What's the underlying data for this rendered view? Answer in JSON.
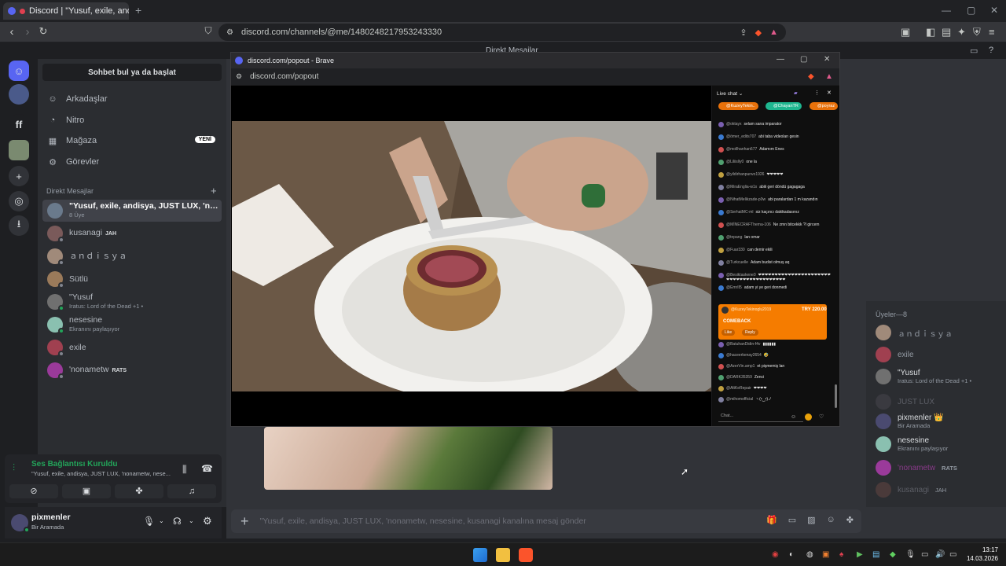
{
  "browser": {
    "tab_title": "Discord | \"Yusuf, exile, andisy...",
    "url": "discord.com/channels/@me/1480248217953243330"
  },
  "discord_top": {
    "title": "Direkt Mesajlar"
  },
  "sidebar": {
    "search": "Sohbet bul ya da başlat",
    "nav": [
      {
        "label": "Arkadaşlar",
        "icon": "friends-icon"
      },
      {
        "label": "Nitro",
        "icon": "nitro-icon"
      },
      {
        "label": "Mağaza",
        "icon": "shop-icon"
      },
      {
        "label": "Görevler",
        "icon": "quests-icon"
      }
    ],
    "new_badge": "YENİ",
    "dm_header": "Direkt Mesajlar",
    "dms": [
      {
        "name": "\"Yusuf, exile, andisya, JUST LUX, 'nona...",
        "sub": "8 Üye",
        "tag": "",
        "color": "#6a7a8c"
      },
      {
        "name": "kusanagi",
        "sub": "",
        "tag": "JAH",
        "color": "#7a5a5a"
      },
      {
        "name": "ａｎｄｉｓｙａ",
        "sub": "",
        "tag": "",
        "color": "#a08a7a"
      },
      {
        "name": "Sütlü",
        "sub": "",
        "tag": "",
        "color": "#9a7a5a"
      },
      {
        "name": "\"Yusuf",
        "sub": "Iratus: Lord of the Dead +1 •",
        "tag": "",
        "color": "#707070"
      },
      {
        "name": "nesesine",
        "sub": "Ekranını paylaşıyor",
        "tag": "",
        "color": "#8ac0b0"
      },
      {
        "name": "exile",
        "sub": "",
        "tag": "",
        "color": "#a04050"
      },
      {
        "name": "'nonametw",
        "sub": "",
        "tag": "RATS",
        "color": "#9a3a9a"
      }
    ]
  },
  "voice": {
    "status": "Ses Bağlantısı Kuruldu",
    "channel": "\"Yusuf, exile, andisya, JUST LUX, 'nonametw, nese..."
  },
  "user": {
    "name": "pixmenler",
    "status": "Bir Aramada"
  },
  "popout": {
    "title": "discord.com/popout - Brave",
    "url": "discord.com/popout"
  },
  "livechat": {
    "header": "Live chat",
    "pills": [
      "@KuzeyTekin..",
      "@ChayanTR",
      "@poyraz"
    ],
    "messages": [
      {
        "user": "@oktayx",
        "text": "selam sana imparator"
      },
      {
        "user": "@ömer_edits707",
        "text": "abi taba videoları gesin"
      },
      {
        "user": "@mollhanhan677",
        "text": "Adamım Enes"
      },
      {
        "user": "@Liliislly0",
        "text": "one la"
      },
      {
        "user": "@yildirhanpunvo1926",
        "text": "❤❤❤❤❤"
      },
      {
        "user": "@MiraEnglia-w1x",
        "text": "abiii geri döndü gagagaga"
      },
      {
        "user": "@NihatMelikzade-p0w",
        "text": "abi paralardan 1 m kazandın"
      },
      {
        "user": "@SerhatMC-ml",
        "text": "siz kaçıncı dakikadasınız"
      },
      {
        "user": "@MİNECRAFThema-106",
        "text": "Ne zmn bitcekkk ?I gircem"
      },
      {
        "user": "@tnpang",
        "text": "lan omar"
      },
      {
        "user": "@Fuar330",
        "text": "can demir ekili"
      },
      {
        "user": "@Turkcuelle",
        "text": "Adam budist olmuş aq"
      },
      {
        "user": "@Besiktaskene0",
        "text": "❤❤❤❤❤❤❤❤❤❤❤❤❤❤❤❤❤❤❤❤❤❤❤❤❤❤❤❤❤❤❤❤❤❤❤❤❤❤❤❤"
      },
      {
        "user": "@EmrII5",
        "text": "adam yi ye geri donmedi"
      }
    ],
    "superchat": {
      "user": "@KuzeyTekinoglu2019",
      "amount": "TRY 220.00",
      "text": "COMEBACK",
      "actions": [
        "Like",
        "Reply"
      ]
    },
    "messages2": [
      {
        "user": "@BatuhanDidin-f4v",
        "text": "▮▮▮▮▮▮"
      },
      {
        "user": "@haceerkenay2654",
        "text": "🤣"
      },
      {
        "user": "@AzerVin.amp1",
        "text": "et pişmemiş lan"
      },
      {
        "user": "@DARK35359",
        "text": "Zenci"
      },
      {
        "user": "@AltKeRepair",
        "text": "❤❤❤❤"
      },
      {
        "user": "@mihomofficial",
        "text": "ヽ(•‿•)ノ"
      }
    ],
    "input_placeholder": "Chat..."
  },
  "members": {
    "header": "Üyeler—8",
    "list": [
      {
        "name": "ａｎｄｉｓｙａ",
        "sub": ""
      },
      {
        "name": "exile",
        "sub": ""
      },
      {
        "name": "\"Yusuf",
        "sub": "Iratus: Lord of the Dead +1 •"
      },
      {
        "name": "JUST LUX",
        "sub": ""
      },
      {
        "name": "pixmenler 👑",
        "sub": "Bir Aramada"
      },
      {
        "name": "nesesine",
        "sub": "Ekranını paylaşıyor"
      },
      {
        "name": "'nonametw",
        "sub": "RATS"
      },
      {
        "name": "kusanagi",
        "sub": "JAH"
      }
    ]
  },
  "message_placeholder": "\"Yusuf, exile, andisya, JUST LUX, 'nonametw, nesesine, kusanagi kanalına mesaj gönder",
  "taskbar": {
    "time": "13:17",
    "date": "14.03.2026"
  },
  "colors": {
    "accent": "#5865f2",
    "online": "#23a55a",
    "superchat": "#f57c00",
    "link": "#00a8fc"
  }
}
